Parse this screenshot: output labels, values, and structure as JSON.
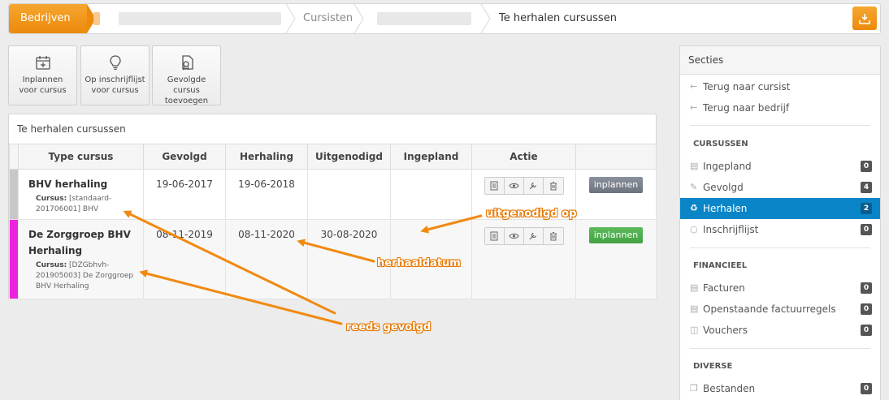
{
  "breadcrumb": {
    "first": "Bedrijven",
    "second": "Cursisten",
    "current": "Te herhalen cursussen"
  },
  "toolbar": [
    {
      "line1": "Inplannen",
      "line2": "voor cursus",
      "icon": "calendar-plus-icon"
    },
    {
      "line1": "Op inschrijflijst",
      "line2": "voor cursus",
      "icon": "lightbulb-icon"
    },
    {
      "line1": "Gevolgde cursus",
      "line2": "toevoegen",
      "icon": "certificate-icon"
    }
  ],
  "panel": {
    "title": "Te herhalen cursussen",
    "columns": [
      "Type cursus",
      "Gevolgd",
      "Herhaling",
      "Uitgenodigd",
      "Ingepland",
      "Actie"
    ],
    "rows": [
      {
        "flag_color": "#c8c8c8",
        "name": "BHV herhaling",
        "sub_label": "Cursus:",
        "sub_line1": "[standaard-",
        "sub_line2": "201706001] BHV",
        "sub_line3": "",
        "gevolgd": "19-06-2017",
        "herhaling": "19-06-2018",
        "uitgenodigd": "",
        "ingepland": "",
        "button": "inplannen"
      },
      {
        "flag_color": "#ee22dd",
        "name": "De Zorggroep BHV",
        "name2": "Herhaling",
        "sub_label": "Cursus:",
        "sub_line1": "[DZGbhvh-",
        "sub_line2": "201905003] De Zorggroep",
        "sub_line3": "BHV Herhaling",
        "gevolgd": "08-11-2019",
        "herhaling": "08-11-2020",
        "uitgenodigd": "30-08-2020",
        "ingepland": "",
        "button": "inplannen"
      }
    ]
  },
  "sidebar": {
    "title": "Secties",
    "back_links": [
      "Terug naar cursist",
      "Terug naar bedrijf"
    ],
    "sections": [
      {
        "heading": "CURSUSSEN",
        "items": [
          {
            "label": "Ingepland",
            "count": "0"
          },
          {
            "label": "Gevolgd",
            "count": "4"
          },
          {
            "label": "Herhalen",
            "count": "2",
            "active": true
          },
          {
            "label": "Inschrijflijst",
            "count": "0"
          }
        ]
      },
      {
        "heading": "FINANCIEEL",
        "items": [
          {
            "label": "Facturen",
            "count": "0"
          },
          {
            "label": "Openstaande factuurregels",
            "count": "0"
          },
          {
            "label": "Vouchers",
            "count": "0"
          }
        ]
      },
      {
        "heading": "DIVERSE",
        "items": [
          {
            "label": "Bestanden",
            "count": "0"
          }
        ]
      }
    ]
  },
  "annotations": {
    "uitgenodigd": "uitgenodigd op",
    "herhaal": "herhaaldatum",
    "gevolgd": "reeds gevolgd"
  },
  "colors": {
    "orange": "#ec8a0c",
    "active_blue": "#0a85c7",
    "green": "#43a243"
  }
}
